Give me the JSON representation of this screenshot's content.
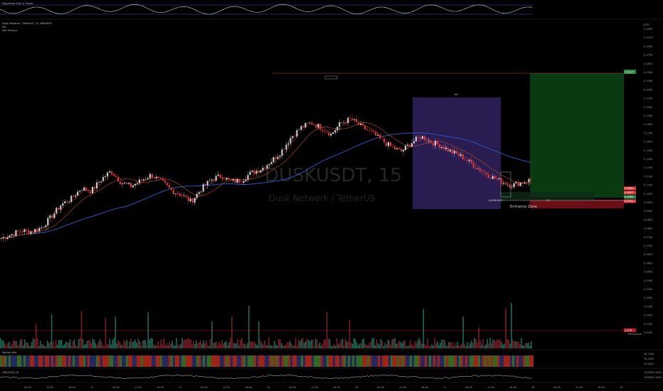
{
  "indicators": {
    "top_title": "Magnetize Fear & Greed",
    "symbol_title": "Dusk Network / TetherUS, 15, BINANCE",
    "sub_line1": "Vol",
    "sub_line2": "Veit Product",
    "bottom1_title": "Market Bits",
    "bottom2_title": "OBV/CVD_18"
  },
  "watermark": {
    "ticker": "DUSKUSDT, 15",
    "name": "Dusk Network / TetherUS"
  },
  "annotations": {
    "zone_label": "Entrance Zone",
    "box_label": "h6",
    "target_tag": "1.0217",
    "small_tag": "0.518",
    "left_note": "0.505 ATR",
    "right_note": "15L",
    "price_line_label": "Resistance"
  },
  "price_axis": {
    "top_label_1": "USDT",
    "labels": [
      "0.2600",
      "0.3150",
      "0.2900",
      "0.2750",
      "0.2630",
      "0.2500",
      "0.2360",
      "0.2250",
      "0.2100",
      "0.2000",
      "0.1900",
      "0.1800",
      "0.1700",
      "0.1600",
      "0.1500",
      "0.1400",
      "0.1300",
      "0.1200",
      "0.1100",
      "0.1000",
      "0.0950",
      "0.0900",
      "0.0850",
      "0.0800",
      "0.0750",
      "0.0700",
      "0.0650",
      "0.0600",
      "0.0550",
      "0.0500",
      "0.0450",
      "0.0400",
      "0.0350",
      "0.0300",
      "0.0250",
      "0.0200"
    ],
    "tags": [
      {
        "text": "0.3061",
        "color": "#e04040"
      },
      {
        "text": "0.3027",
        "color": "#e04040"
      },
      {
        "text": "0.2990",
        "color": "#2a8a4a"
      },
      {
        "text": "0.2922",
        "color": "#e04040"
      }
    ],
    "volume_tag": "1.578",
    "osc_labels": [
      "46.1000",
      "34.0000",
      "25.0000"
    ],
    "obv_labels": [
      "1500000.0000",
      "1000000.0000"
    ]
  },
  "time_axis": {
    "labels": [
      "06:00",
      "12:00",
      "18:00",
      "13",
      "06:00",
      "12:00",
      "18:00",
      "14",
      "06:00",
      "12:00",
      "18:00",
      "15",
      "06:00",
      "12:00",
      "18:00",
      "16",
      "06:00",
      "12:00",
      "18:00",
      "17",
      "06:00",
      "12:00",
      "18:00",
      "18",
      "06:00",
      "12:00",
      "18:00",
      "19"
    ]
  },
  "chart_data": {
    "type": "candlestick",
    "title": "Dusk Network / TetherUS, 15, BINANCE",
    "xlabel": "",
    "ylabel": "USDT",
    "series": [
      {
        "name": "price (approx. close path)",
        "values": [
          0.09,
          0.094,
          0.098,
          0.097,
          0.101,
          0.112,
          0.125,
          0.131,
          0.142,
          0.139,
          0.151,
          0.16,
          0.148,
          0.144,
          0.15,
          0.156,
          0.149,
          0.14,
          0.135,
          0.128,
          0.141,
          0.151,
          0.155,
          0.149,
          0.15,
          0.158,
          0.162,
          0.17,
          0.18,
          0.195,
          0.205,
          0.21,
          0.205,
          0.198,
          0.21,
          0.214,
          0.206,
          0.2,
          0.192,
          0.185,
          0.18,
          0.189,
          0.196,
          0.19,
          0.186,
          0.18,
          0.175,
          0.168,
          0.16,
          0.154,
          0.149,
          0.145,
          0.148,
          0.151
        ]
      }
    ],
    "ylim": [
      0.02,
      0.26
    ],
    "grid": false
  },
  "colors": {
    "up": "#d4d4d4",
    "down": "#e23a3a",
    "ma_slow": "#2d5fd0",
    "ma_mid": "#c0561a",
    "zone_purple": "#2a1d55",
    "zone_green": "#0a3a12",
    "zone_red": "#6a0d14"
  }
}
